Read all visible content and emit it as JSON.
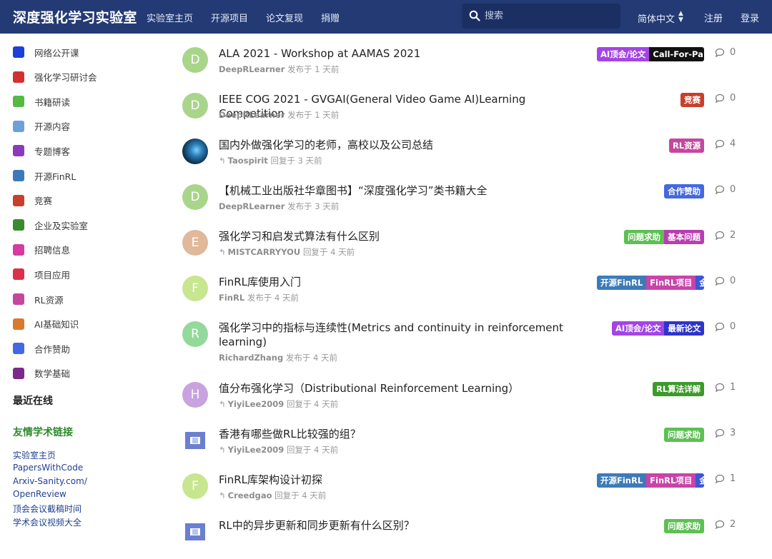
{
  "header": {
    "brand": "深度强化学习实验室",
    "nav": [
      "实验室主页",
      "开源项目",
      "论文复现",
      "捐赠"
    ],
    "search_placeholder": "搜索",
    "language": "简体中文",
    "register": "注册",
    "login": "登录"
  },
  "sidebar": {
    "categories": [
      {
        "label": "网络公开课",
        "color": "#1c3fd9"
      },
      {
        "label": "强化学习研讨会",
        "color": "#d33131"
      },
      {
        "label": "书籍研读",
        "color": "#57b845"
      },
      {
        "label": "开源内容",
        "color": "#6ea0d8"
      },
      {
        "label": "专题博客",
        "color": "#8a3bbd"
      },
      {
        "label": "开源FinRL",
        "color": "#3d7bb8"
      },
      {
        "label": "竞赛",
        "color": "#c7402b"
      },
      {
        "label": "企业及实验室",
        "color": "#3c8a2e"
      },
      {
        "label": "招聘信息",
        "color": "#d63aa3"
      },
      {
        "label": "项目应用",
        "color": "#d8334a"
      },
      {
        "label": "RL资源",
        "color": "#c4479e"
      },
      {
        "label": "AI基础知识",
        "color": "#d77a2f"
      },
      {
        "label": "合作赞助",
        "color": "#4468e0"
      },
      {
        "label": "数学基础",
        "color": "#7a2a8a"
      }
    ],
    "online_heading": "最近在线",
    "links_heading": "友情学术链接",
    "links": [
      "实验室主页",
      "PapersWithCode",
      "Arxiv-Sanity.com/",
      "OpenReview",
      "顶会会议截稿时间",
      "学术会议视频大全"
    ]
  },
  "topics": [
    {
      "title": "ALA 2021 - Workshop at AAMAS 2021",
      "user": "DeepRLearner",
      "action": "发布于 1 天前",
      "reply": false,
      "avatar_letter": "D",
      "avatar_color": "#a8d58a",
      "tags": [
        {
          "label": "AI顶会/论文",
          "color": "#a444e6"
        },
        {
          "label": "Call-For-Pa",
          "color": "#111111"
        }
      ],
      "count": "0"
    },
    {
      "title": "IEEE COG 2021 - GVGAI(General Video Game AI)Learning Competition",
      "user": "DeepRLearner",
      "action": "发布于 1 天前",
      "reply": false,
      "avatar_letter": "D",
      "avatar_color": "#a8d58a",
      "tags": [
        {
          "label": "竞赛",
          "color": "#c7402b"
        }
      ],
      "count": "0"
    },
    {
      "title": "国内外做强化学习的老师，高校以及公司总结",
      "user": "Taospirit",
      "action": "回复于 3 天前",
      "reply": true,
      "avatar_letter": "",
      "avatar_color": "#0e3a5a",
      "tags": [
        {
          "label": "RL资源",
          "color": "#c4479e"
        }
      ],
      "count": "4"
    },
    {
      "title": "【机械工业出版社华章图书】“深度强化学习”类书籍大全",
      "user": "DeepRLearner",
      "action": "发布于 3 天前",
      "reply": false,
      "avatar_letter": "D",
      "avatar_color": "#a8d58a",
      "tags": [
        {
          "label": "合作赞助",
          "color": "#4468e0"
        }
      ],
      "count": "0"
    },
    {
      "title": "强化学习和启发式算法有什么区别",
      "user": "MISTCARRYYOU",
      "action": "回复于 4 天前",
      "reply": true,
      "avatar_letter": "E",
      "avatar_color": "#e0b89a",
      "tags": [
        {
          "label": "问题求助",
          "color": "#5cc052"
        },
        {
          "label": "基本问题",
          "color": "#b93db0"
        }
      ],
      "count": "2"
    },
    {
      "title": "FinRL库使用入门",
      "user": "FinRL",
      "action": "发布于 4 天前",
      "reply": false,
      "avatar_letter": "F",
      "avatar_color": "#c7e68f",
      "tags": [
        {
          "label": "开源FinRL",
          "color": "#3d7bb8"
        },
        {
          "label": "FinRL项目",
          "color": "#c844a8"
        },
        {
          "label": "金",
          "color": "#3b57d6"
        }
      ],
      "count": "0"
    },
    {
      "title": "强化学习中的指标与连续性(Metrics and continuity in reinforcement learning)",
      "user": "RichardZhang",
      "action": "发布于 4 天前",
      "reply": false,
      "avatar_letter": "R",
      "avatar_color": "#93d99c",
      "tags": [
        {
          "label": "AI顶会/论文",
          "color": "#a444e6"
        },
        {
          "label": "最新论文",
          "color": "#2f34c9"
        }
      ],
      "count": "0"
    },
    {
      "title": "值分布强化学习（Distributional Reinforcement Learning）",
      "user": "YiyiLee2009",
      "action": "回复于 4 天前",
      "reply": true,
      "avatar_letter": "H",
      "avatar_color": "#c8a3df",
      "tags": [
        {
          "label": "RL算法详解",
          "color": "#3d9a2a"
        }
      ],
      "count": "1"
    },
    {
      "title": "香港有哪些做RL比较强的组？",
      "user": "YiyiLee2009",
      "action": "回复于 4 天前",
      "reply": true,
      "avatar_letter": "",
      "avatar_color": "#ffffff",
      "tags": [
        {
          "label": "问题求助",
          "color": "#5cc052"
        }
      ],
      "count": "3"
    },
    {
      "title": "FinRL库架构设计初探",
      "user": "Creedgao",
      "action": "回复于 4 天前",
      "reply": true,
      "avatar_letter": "F",
      "avatar_color": "#c7e68f",
      "tags": [
        {
          "label": "开源FinRL",
          "color": "#3d7bb8"
        },
        {
          "label": "FinRL项目",
          "color": "#c844a8"
        },
        {
          "label": "金",
          "color": "#3b57d6"
        }
      ],
      "count": "1"
    },
    {
      "title": "RL中的异步更新和同步更新有什么区别？",
      "user": "",
      "action": "",
      "reply": true,
      "avatar_letter": "",
      "avatar_color": "#ffffff",
      "tags": [
        {
          "label": "问题求助",
          "color": "#5cc052"
        }
      ],
      "count": "2"
    }
  ]
}
